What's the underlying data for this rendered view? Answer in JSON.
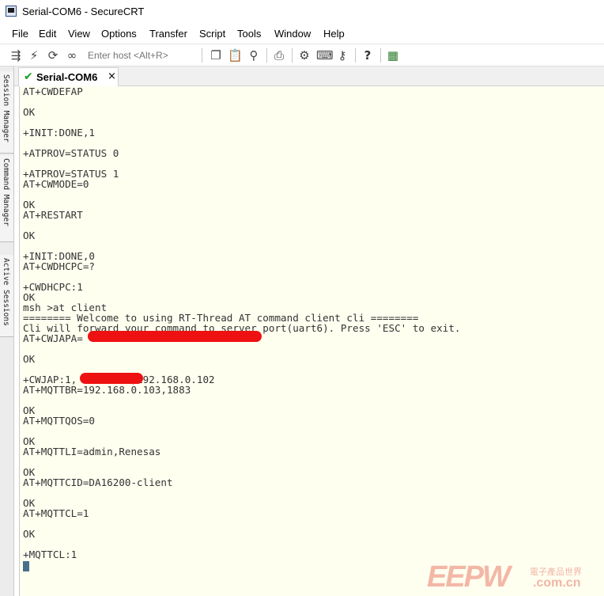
{
  "window": {
    "title": "Serial-COM6 - SecureCRT"
  },
  "menu": [
    "File",
    "Edit",
    "View",
    "Options",
    "Transfer",
    "Script",
    "Tools",
    "Window",
    "Help"
  ],
  "toolbar": {
    "host_placeholder": "Enter host <Alt+R>",
    "icons": [
      "connect-icon",
      "lightning-icon",
      "reconnect-icon",
      "link-icon",
      "copy-icon",
      "paste-icon",
      "find-icon",
      "print-icon",
      "settings-icon",
      "keymap-icon",
      "key-icon",
      "help-icon",
      "sftp-icon"
    ]
  },
  "sidebar": {
    "tabs": [
      "Session Manager",
      "Command Manager",
      "Active Sessions"
    ]
  },
  "session_tab": {
    "label": "Serial-COM6",
    "close": "×"
  },
  "terminal": {
    "lines": [
      "AT+CWDEFAP",
      "",
      "OK",
      "",
      "+INIT:DONE,1",
      "",
      "+ATPROV=STATUS 0",
      "",
      "+ATPROV=STATUS 1",
      "AT+CWMODE=0",
      "",
      "OK",
      "AT+RESTART",
      "",
      "OK",
      "",
      "+INIT:DONE,0",
      "AT+CWDHCPC=?",
      "",
      "+CWDHCPC:1",
      "OK",
      "msh >at client",
      "======== Welcome to using RT-Thread AT command client cli ========",
      "Cli will forward your command to server port(uart6). Press 'ESC' to exit.",
      "AT+CWJAPA=",
      "",
      "OK",
      "",
      "+CWJAP:1,         ,192.168.0.102",
      "AT+MQTTBR=192.168.0.103,1883",
      "",
      "OK",
      "AT+MQTTQOS=0",
      "",
      "OK",
      "AT+MQTTLI=admin,Renesas",
      "",
      "OK",
      "AT+MQTTCID=DA16200-client",
      "",
      "OK",
      "AT+MQTTCL=1",
      "",
      "OK",
      "",
      "+MQTTCL:1"
    ]
  },
  "watermark": {
    "logo": "EEPW",
    "sub": "電子產品世界",
    "url": ".com.cn"
  },
  "colors": {
    "terminal_bg": "#fffff0",
    "terminal_fg": "#333333",
    "redaction": "#ee1111",
    "tab_check": "#1aa01a"
  }
}
